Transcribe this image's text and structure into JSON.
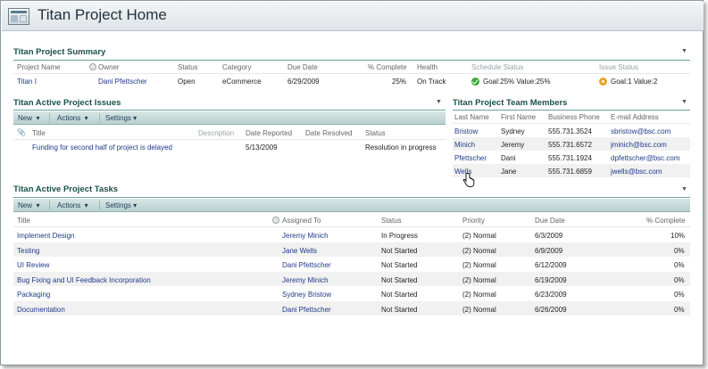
{
  "page": {
    "title": "Titan Project Home"
  },
  "summary": {
    "title": "Titan Project Summary",
    "headers": [
      "Project Name",
      "Owner",
      "Status",
      "Category",
      "Due Date",
      "% Complete",
      "Health",
      "Schedule Status",
      "Issue Status"
    ],
    "row": {
      "name": "Titan I",
      "owner": "Dani Pfettscher",
      "status": "Open",
      "category": "eCommerce",
      "due": "6/29/2009",
      "complete": "25%",
      "health": "On Track",
      "schedule": "Goal:25% Value:25%",
      "issue": "Goal:1 Value:2"
    }
  },
  "issues": {
    "title": "Titan Active Project Issues",
    "toolbar": {
      "new": "New",
      "actions": "Actions",
      "settings": "Settings"
    },
    "headers": {
      "title": "Title",
      "description": "Description",
      "reported": "Date Reported",
      "resolved": "Date Resolved",
      "status": "Status"
    },
    "rows": [
      {
        "title": "Funding for second half of project is delayed",
        "reported": "5/13/2009",
        "resolved": "",
        "status": "Resolution in progress"
      }
    ]
  },
  "team": {
    "title": "Titan Project Team Members",
    "headers": {
      "last": "Last Name",
      "first": "First Name",
      "phone": "Business Phone",
      "email": "E-mail Address"
    },
    "rows": [
      {
        "last": "Bristow",
        "first": "Sydney",
        "phone": "555.731.3524",
        "email": "sbristow@bsc.com"
      },
      {
        "last": "Minich",
        "first": "Jeremy",
        "phone": "555.731.6572",
        "email": "jminich@bsc.com"
      },
      {
        "last": "Pfettscher",
        "first": "Dani",
        "phone": "555.731.1924",
        "email": "dpfettscher@bsc.com"
      },
      {
        "last": "Wells",
        "first": "Jane",
        "phone": "555.731.6859",
        "email": "jwells@bsc.com"
      }
    ]
  },
  "tasks": {
    "title": "Titan Active Project Tasks",
    "toolbar": {
      "new": "New",
      "actions": "Actions",
      "settings": "Settings"
    },
    "headers": {
      "title": "Title",
      "assigned": "Assigned To",
      "status": "Status",
      "priority": "Priority",
      "due": "Due Date",
      "complete": "% Complete"
    },
    "rows": [
      {
        "title": "Implement Design",
        "assigned": "Jeremy Minich",
        "status": "In Progress",
        "priority": "(2) Normal",
        "due": "6/3/2009",
        "complete": "10%"
      },
      {
        "title": "Testing",
        "assigned": "Jane Wells",
        "status": "Not Started",
        "priority": "(2) Normal",
        "due": "6/9/2009",
        "complete": "0%"
      },
      {
        "title": "UI Review",
        "assigned": "Dani Pfettscher",
        "status": "Not Started",
        "priority": "(2) Normal",
        "due": "6/12/2009",
        "complete": "0%"
      },
      {
        "title": "Bug Fixing and UI Feedback Incorporation",
        "assigned": "Jeremy Minich",
        "status": "Not Started",
        "priority": "(2) Normal",
        "due": "6/19/2009",
        "complete": "0%"
      },
      {
        "title": "Packaging",
        "assigned": "Sydney Bristow",
        "status": "Not Started",
        "priority": "(2) Normal",
        "due": "6/23/2009",
        "complete": "0%"
      },
      {
        "title": "Documentation",
        "assigned": "Dani Pfettscher",
        "status": "Not Started",
        "priority": "(2) Normal",
        "due": "6/26/2009",
        "complete": "0%"
      }
    ]
  }
}
